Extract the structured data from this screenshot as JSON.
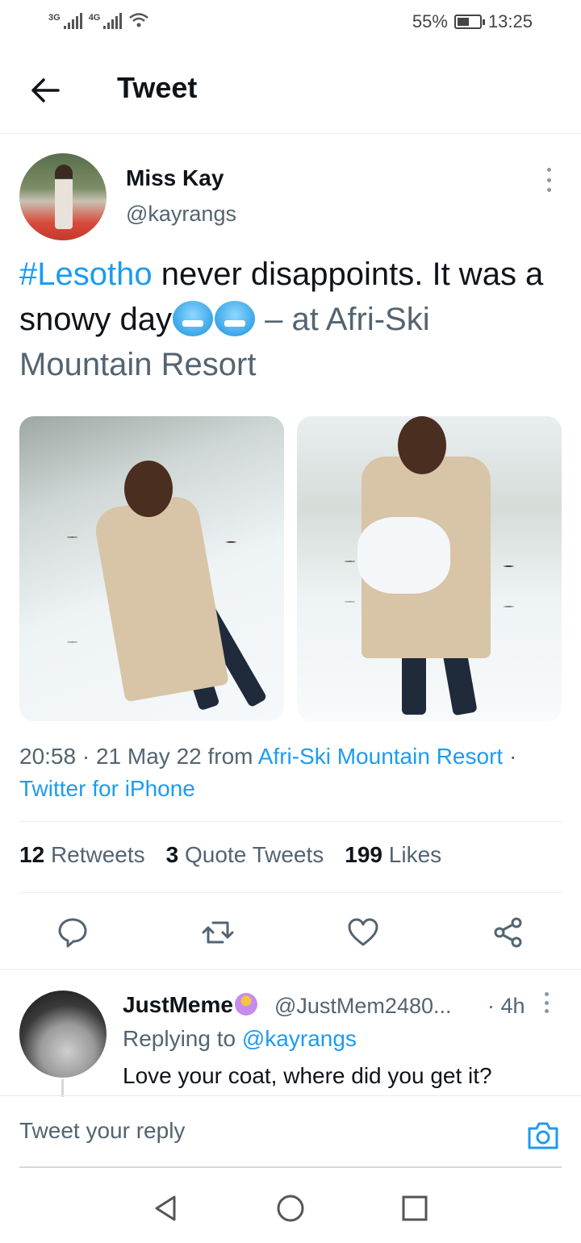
{
  "status_bar": {
    "signal1_label": "3G",
    "signal2_label": "4G",
    "battery_percent": "55%",
    "battery_level": 0.55,
    "time": "13:25"
  },
  "header": {
    "title": "Tweet"
  },
  "tweet": {
    "author_name": "Miss Kay",
    "author_handle": "@kayrangs",
    "hashtag": "#Lesotho",
    "text_part1": " never disappoints.  It was a snowy day",
    "text_part2": " – at ",
    "location": "Afri-Ski Mountain Resort",
    "emojis": [
      "cold-face-emoji",
      "cold-face-emoji"
    ],
    "time": "20:58",
    "date": "21 May 22",
    "from_label": "from",
    "place": "Afri-Ski Mountain Resort",
    "client": "Twitter for iPhone"
  },
  "stats": {
    "retweets_count": "12",
    "retweets_label": "Retweets",
    "quotes_count": "3",
    "quotes_label": "Quote Tweets",
    "likes_count": "199",
    "likes_label": "Likes"
  },
  "actions": [
    "reply-icon",
    "retweet-icon",
    "like-icon",
    "share-icon"
  ],
  "reply": {
    "name": "JustMeme",
    "handle": "@JustMem2480...",
    "time": "· 4h",
    "replying_label": "Replying to ",
    "replying_to": "@kayrangs",
    "text": "Love your coat, where did you get it?"
  },
  "compose": {
    "placeholder": "Tweet your reply"
  },
  "colors": {
    "accent": "#1d9bf0",
    "text": "#0f1419",
    "secondary": "#536471"
  }
}
